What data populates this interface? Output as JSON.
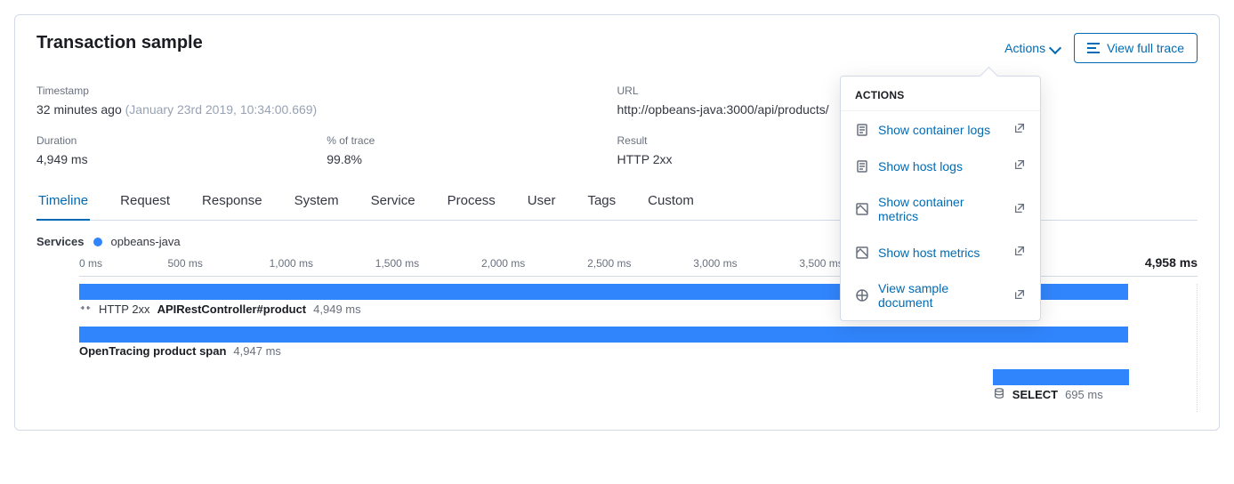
{
  "header": {
    "title": "Transaction sample",
    "actions_label": "Actions",
    "view_trace_label": "View full trace"
  },
  "meta": {
    "timestamp_label": "Timestamp",
    "timestamp_relative": "32 minutes ago",
    "timestamp_absolute": "(January 23rd 2019, 10:34:00.669)",
    "url_label": "URL",
    "url_value": "http://opbeans-java:3000/api/products/",
    "duration_label": "Duration",
    "duration_value": "4,949 ms",
    "pct_trace_label": "% of trace",
    "pct_trace_value": "99.8%",
    "result_label": "Result",
    "result_value": "HTTP 2xx"
  },
  "tabs": [
    "Timeline",
    "Request",
    "Response",
    "System",
    "Service",
    "Process",
    "User",
    "Tags",
    "Custom"
  ],
  "active_tab_index": 0,
  "services": {
    "label": "Services",
    "items": [
      "opbeans-java"
    ]
  },
  "timeline": {
    "ticks": [
      "0 ms",
      "500 ms",
      "1,000 ms",
      "1,500 ms",
      "2,000 ms",
      "2,500 ms",
      "3,000 ms",
      "3,500 ms"
    ],
    "end_label": "4,958 ms",
    "rows": [
      {
        "status": "HTTP 2xx",
        "name": "APIRestController#product",
        "duration": "4,949 ms",
        "left_pct": 0,
        "width_pct": 99.8
      },
      {
        "status": "",
        "name": "OpenTracing product span",
        "duration": "4,947 ms",
        "left_pct": 0,
        "width_pct": 99.76
      },
      {
        "status": "",
        "name": "SELECT",
        "duration": "695 ms",
        "left_pct": 86.9,
        "width_pct": 13.0,
        "db": true
      }
    ]
  },
  "actions_menu": {
    "title": "ACTIONS",
    "items": [
      "Show container logs",
      "Show host logs",
      "Show container metrics",
      "Show host metrics",
      "View sample document"
    ]
  },
  "colors": {
    "accent": "#006bb4",
    "bar": "#3185fc"
  }
}
